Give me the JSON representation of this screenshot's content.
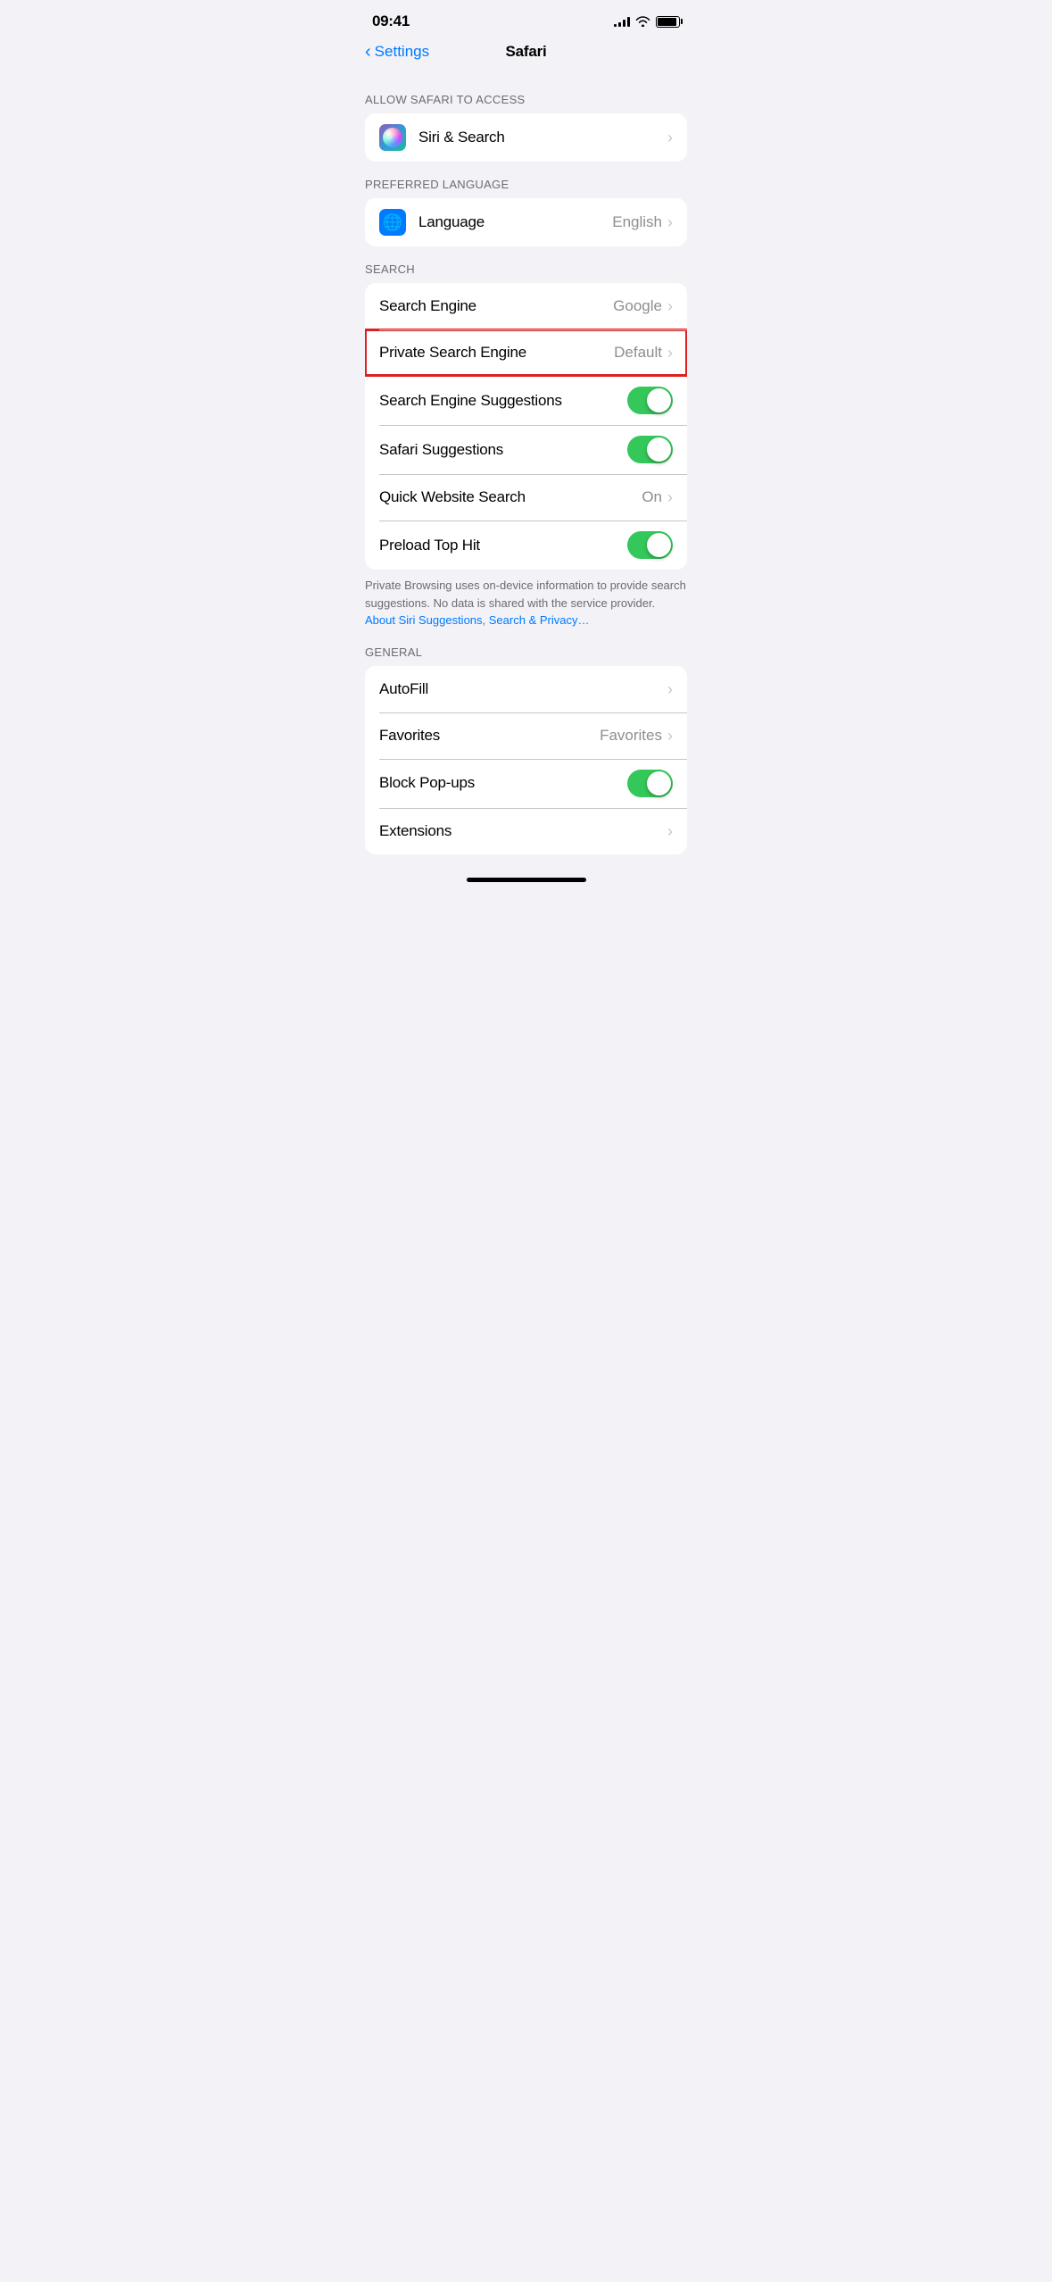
{
  "statusBar": {
    "time": "09:41",
    "signal": 4,
    "wifi": true,
    "battery": 90
  },
  "navBar": {
    "backLabel": "Settings",
    "title": "Safari"
  },
  "sections": {
    "allowSafariAccess": {
      "header": "ALLOW SAFARI TO ACCESS",
      "items": [
        {
          "id": "siri-search",
          "icon": "siri",
          "label": "Siri & Search",
          "chevron": true
        }
      ]
    },
    "preferredLanguage": {
      "header": "PREFERRED LANGUAGE",
      "items": [
        {
          "id": "language",
          "icon": "language",
          "label": "Language",
          "value": "English",
          "chevron": true
        }
      ]
    },
    "search": {
      "header": "SEARCH",
      "items": [
        {
          "id": "search-engine",
          "label": "Search Engine",
          "value": "Google",
          "chevron": true,
          "highlighted": false
        },
        {
          "id": "private-search-engine",
          "label": "Private Search Engine",
          "value": "Default",
          "chevron": true,
          "highlighted": true
        },
        {
          "id": "search-engine-suggestions",
          "label": "Search Engine Suggestions",
          "toggle": true,
          "toggleOn": true
        },
        {
          "id": "safari-suggestions",
          "label": "Safari Suggestions",
          "toggle": true,
          "toggleOn": true
        },
        {
          "id": "quick-website-search",
          "label": "Quick Website Search",
          "value": "On",
          "chevron": true
        },
        {
          "id": "preload-top-hit",
          "label": "Preload Top Hit",
          "toggle": true,
          "toggleOn": true
        }
      ],
      "footer": "Private Browsing uses on-device information to provide search suggestions. No data is shared with the service provider.",
      "footerLinks": [
        {
          "text": "About Siri Suggestions",
          "url": "#"
        },
        {
          "text": "Search & Privacy…",
          "url": "#"
        }
      ]
    },
    "general": {
      "header": "GENERAL",
      "items": [
        {
          "id": "autofill",
          "label": "AutoFill",
          "chevron": true
        },
        {
          "id": "favorites",
          "label": "Favorites",
          "value": "Favorites",
          "chevron": true
        },
        {
          "id": "block-popups",
          "label": "Block Pop-ups",
          "toggle": true,
          "toggleOn": true
        },
        {
          "id": "extensions",
          "label": "Extensions",
          "chevron": true
        }
      ]
    }
  }
}
